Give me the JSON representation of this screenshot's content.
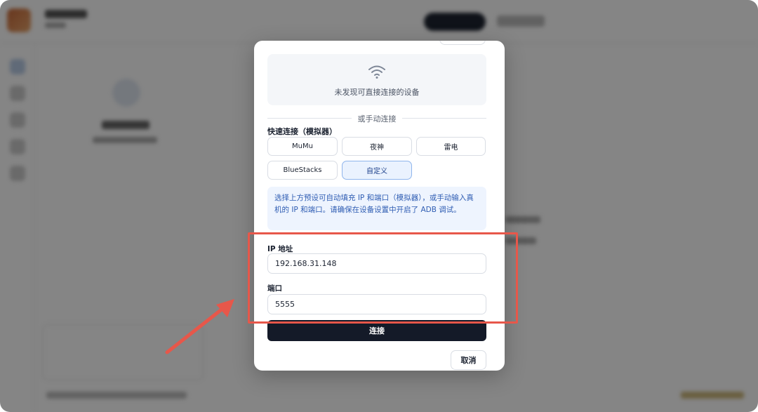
{
  "dialog": {
    "discover": {
      "icon": "wifi-icon",
      "text": "未发现可直接连接的设备"
    },
    "divider_text": "或手动连接",
    "quick_connect": {
      "title": "快速连接（模拟器）",
      "presets": [
        {
          "label": "MuMu",
          "active": false
        },
        {
          "label": "夜神",
          "active": false
        },
        {
          "label": "雷电",
          "active": false
        },
        {
          "label": "BlueStacks",
          "active": false
        },
        {
          "label": "自定义",
          "active": true
        }
      ]
    },
    "info_text": "选择上方预设可自动填充 IP 和端口（模拟器），或手动输入真机的 IP 和端口。请确保在设备设置中开启了 ADB 调试。",
    "ip_field": {
      "label": "IP 地址",
      "value": "192.168.31.148"
    },
    "port_field": {
      "label": "端口",
      "value": "5555"
    },
    "connect_label": "连接",
    "cancel_label": "取消"
  },
  "annotation": {
    "color": "#e7574a"
  },
  "colors": {
    "primary_dark": "#141a28",
    "info_bg": "#eef4fe",
    "info_text": "#2f5db3",
    "active_preset_bg": "#eaf2fe"
  }
}
